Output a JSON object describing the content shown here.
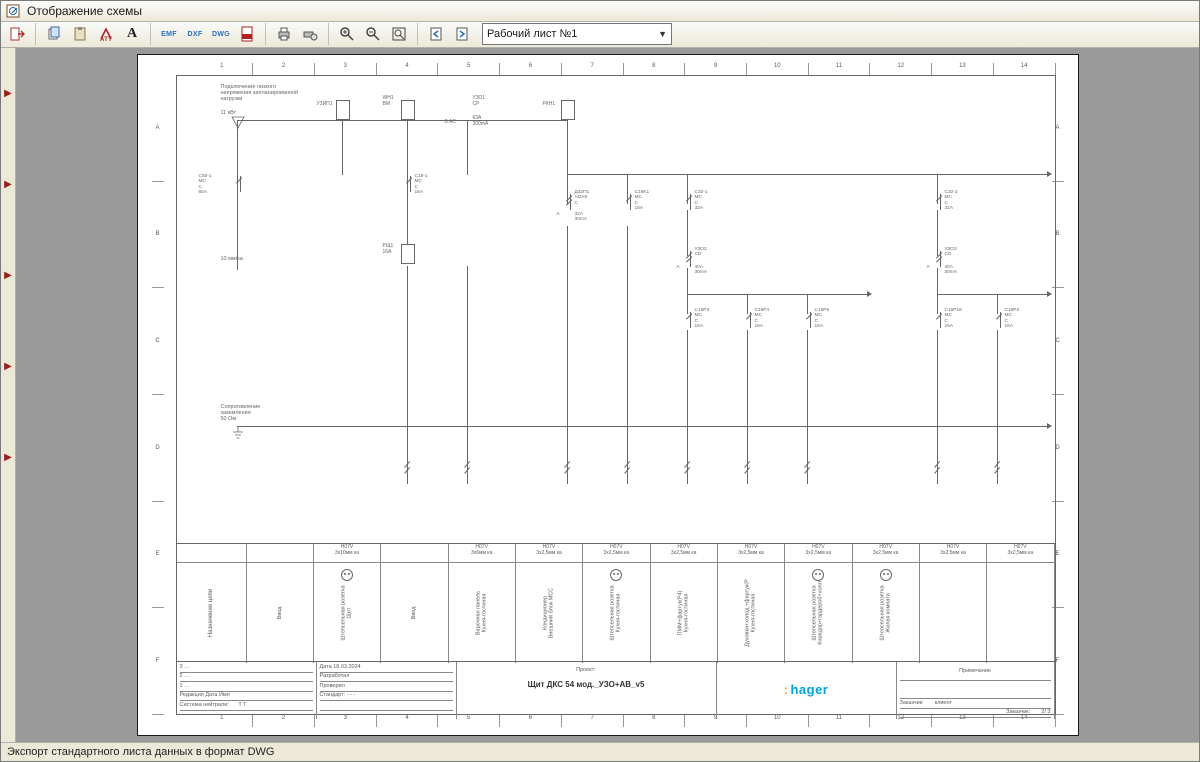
{
  "window": {
    "title": "Отображение схемы"
  },
  "toolbar": {
    "tooltip_exit": "Выход",
    "tooltip_copy": "Копировать",
    "tooltip_paste": "Вставить",
    "tooltip_att": "Атрибуты",
    "tooltip_text": "Текст",
    "tooltip_emf": "EMF",
    "tooltip_dxf": "DXF",
    "tooltip_dwg": "DWG",
    "tooltip_pdf": "PDF",
    "tooltip_print": "Печать",
    "tooltip_printset": "Параметры печати",
    "tooltip_zoomin": "Увеличить",
    "tooltip_zoomout": "Уменьшить",
    "tooltip_zoomfit": "Показать всё",
    "tooltip_prev": "Предыдущий лист",
    "tooltip_next": "Следующий лист"
  },
  "sheet_selector": {
    "value": "Рабочий лист №1"
  },
  "status": {
    "text": "Экспорт стандартного листа данных в формат DWG"
  },
  "ruler": {
    "cols": [
      "1",
      "2",
      "3",
      "4",
      "5",
      "6",
      "7",
      "8",
      "9",
      "10",
      "11",
      "12",
      "13",
      "14"
    ],
    "rows": [
      "A",
      "B",
      "C",
      "D",
      "E",
      "F"
    ]
  },
  "diagram": {
    "incoming_note": "Подключение низкого\nнапряжения запланированной\nнагрузки",
    "power": "11 кВт",
    "cable": "10 мм/ка",
    "earth_note": "Сопротивление\nзаземления\n50 Ом",
    "devices": {
      "c50": {
        "tag": "C50-1",
        "type": "MC",
        "poles": "C",
        "rating": "50A"
      },
      "uzip": {
        "tag": "УЗИП1"
      },
      "wh1": {
        "tag": "WH1",
        "type": "BM"
      },
      "uzo1": {
        "tag": "УЗО1",
        "type": "CP",
        "rating": "63A",
        "sens": "300mA",
        "extra": "B AC"
      },
      "rkn": {
        "tag": "РКН1"
      },
      "c16_1": {
        "tag": "C16-1",
        "type": "MC",
        "poles": "C",
        "rating": "16A"
      },
      "rsh1": {
        "tag": "РЩ1",
        "rating": "16A"
      },
      "d32": {
        "tag": "Д32П1",
        "type": "ADA9",
        "poles": "C",
        "rating": "32A",
        "sens": "30mA"
      },
      "c16k": {
        "tag": "C16K1",
        "type": "MC",
        "poles": "C",
        "rating": "16A"
      },
      "c32_1": {
        "tag": "C32-1",
        "type": "MC",
        "poles": "C",
        "rating": "32A"
      },
      "c32_2": {
        "tag": "C32-2",
        "type": "MC",
        "poles": "C",
        "rating": "32A"
      },
      "uzo2": {
        "tag": "УЗО2",
        "type": "CD",
        "rating": "40A",
        "sens": "30mA"
      },
      "uzo3": {
        "tag": "УЗО3",
        "type": "CD",
        "rating": "40A",
        "sens": "30mA"
      },
      "c16p3": {
        "tag": "C16P3",
        "type": "MC",
        "poles": "C",
        "rating": "16A"
      },
      "c16p4": {
        "tag": "C16P4",
        "type": "MC",
        "poles": "C",
        "rating": "16A"
      },
      "c16p5": {
        "tag": "C16P5",
        "type": "MC",
        "poles": "C",
        "rating": "16A"
      },
      "c16p16": {
        "tag": "C16P16",
        "type": "MC",
        "poles": "C",
        "rating": "16A"
      },
      "c16p2": {
        "tag": "C16P2",
        "type": "MC",
        "poles": "C",
        "rating": "16A"
      }
    }
  },
  "cable_header": "Назначение цепи",
  "cables": [
    "",
    "H07V\n3x10мм ка",
    "",
    "H07V\n3x6мм ка",
    "H07V\n3x2,5мм ка",
    "H07V\n3x2,5мм ка",
    "H07V\n3x2,5мм ка",
    "H07V\n3x2,5мм ка",
    "H07V\n3x2,5мм ка",
    "H07V\n3x2,5мм ка",
    "H07V\n3x2,5мм ка",
    "H07V\n3x2,5мм ка"
  ],
  "circuits": [
    {
      "l1": "Ввод",
      "l2": ""
    },
    {
      "l1": "Штепсельная розетка",
      "l2": "Щит",
      "icon": true
    },
    {
      "l1": "Ввод",
      "l2": ""
    },
    {
      "l1": "Варочная панель",
      "l2": "Кухня-гостиная"
    },
    {
      "l1": "Кондиционер",
      "l2": "Внешний блок МСС"
    },
    {
      "l1": "Штепсельная розетка",
      "l2": "Кухня-гостиная",
      "icon": true
    },
    {
      "l1": "ПММ+фартук(Р4)",
      "l2": "Кухня-гостиная"
    },
    {
      "l1": "Духовка+холод.+фартук(Р",
      "l2": "Кухня-гостиная"
    },
    {
      "l1": "Штепсельная розетка",
      "l2": "Коридор+гардероб+холл",
      "icon": true
    },
    {
      "l1": "Штепсельная розетка",
      "l2": "Жилая комната",
      "icon": true
    }
  ],
  "titleblock": {
    "rows_left": [
      "3 …",
      "2 …",
      "1 …",
      "Редакция    Дата    Имя"
    ],
    "rows_mid": [
      "Дата     18.03.2024",
      "Разработал",
      "Проверил",
      "Стандарт:   - - -"
    ],
    "project_label": "Проект:",
    "project_name": "Щит ДКС 54 мод._УЗО+АВ_v5",
    "brand": "hager",
    "customer_lbl": "Заказчик:",
    "customer": "клиент",
    "sheet_lbl": "Заказчик:",
    "sheet": "2/ 3",
    "note_lbl": "Примечание",
    "neutral_lbl": "Система нейтрали:",
    "neutral": "T T"
  }
}
